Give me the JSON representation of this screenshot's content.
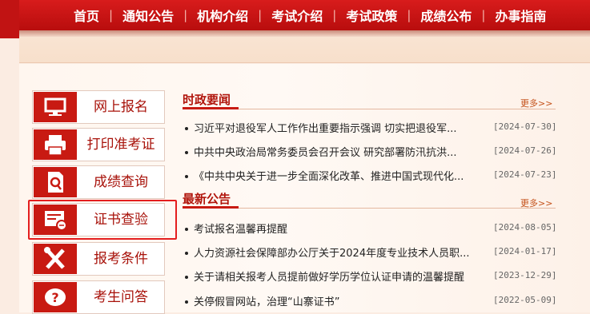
{
  "nav": {
    "items": [
      "首页",
      "通知公告",
      "机构介绍",
      "考试介绍",
      "考试政策",
      "成绩公布",
      "办事指南"
    ],
    "separator": "|"
  },
  "sidebar": {
    "items": [
      {
        "label": "网上报名",
        "icon": "monitor-icon"
      },
      {
        "label": "打印准考证",
        "icon": "printer-icon"
      },
      {
        "label": "成绩查询",
        "icon": "search-document-icon"
      },
      {
        "label": "证书查验",
        "icon": "certificate-check-icon"
      },
      {
        "label": "报考条件",
        "icon": "tools-icon"
      },
      {
        "label": "考生问答",
        "icon": "question-icon"
      }
    ]
  },
  "sections": {
    "politics": {
      "title": "时政要闻",
      "more": "更多>>",
      "items": [
        {
          "text": "习近平对退役军人工作作出重要指示强调 切实把退役军...",
          "date": "[2024-07-30]"
        },
        {
          "text": "中共中央政治局常务委员会召开会议 研究部署防汛抗洪...",
          "date": "[2024-07-26]"
        },
        {
          "text": "《中共中央关于进一步全面深化改革、推进中国式现代化...",
          "date": "[2024-07-23]"
        }
      ]
    },
    "notices": {
      "title": "最新公告",
      "more": "更多>>",
      "items": [
        {
          "text": "考试报名温馨再提醒",
          "date": "[2024-08-05]"
        },
        {
          "text": "人力资源社会保障部办公厅关于2024年度专业技术人员职...",
          "date": "[2024-01-17]"
        },
        {
          "text": "关于请相关报考人员提前做好学历学位认证申请的温馨提醒",
          "date": "[2023-12-29]"
        },
        {
          "text": "关停假冒网站，治理“山寨证书”",
          "date": "[2022-05-09]"
        }
      ]
    }
  },
  "colors": {
    "brand_red": "#c81a12",
    "highlight_border": "#e41e1e",
    "page_bg": "#fbece2"
  }
}
